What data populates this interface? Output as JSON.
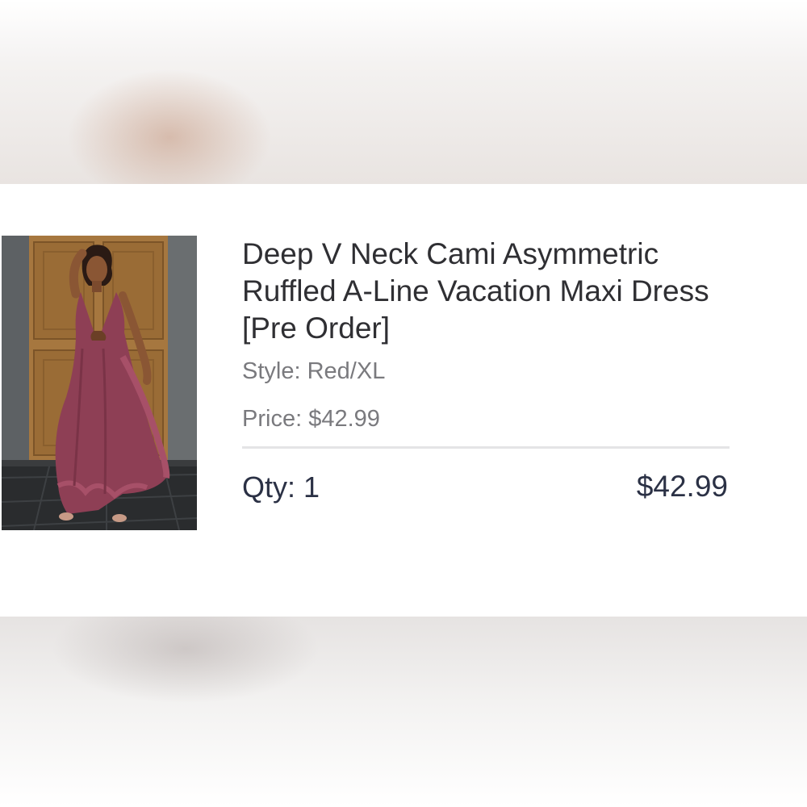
{
  "product": {
    "title": "Deep V Neck Cami Asymmetric Ruffled A-Line Vacation Maxi Dress [Pre Order]",
    "style_label": "Style:",
    "style_value": "Red/XL",
    "price_label": "Price:",
    "price_value": "$42.99",
    "image_icon": "product-photo-dress"
  },
  "line_item": {
    "qty_label": "Qty:",
    "qty_value": "1",
    "line_total": "$42.99"
  },
  "colors": {
    "dress": "#8e3f55",
    "door": "#a0733e",
    "text_primary": "#2f2f33",
    "text_secondary": "#7a7a7e",
    "text_accent": "#2b3145"
  }
}
